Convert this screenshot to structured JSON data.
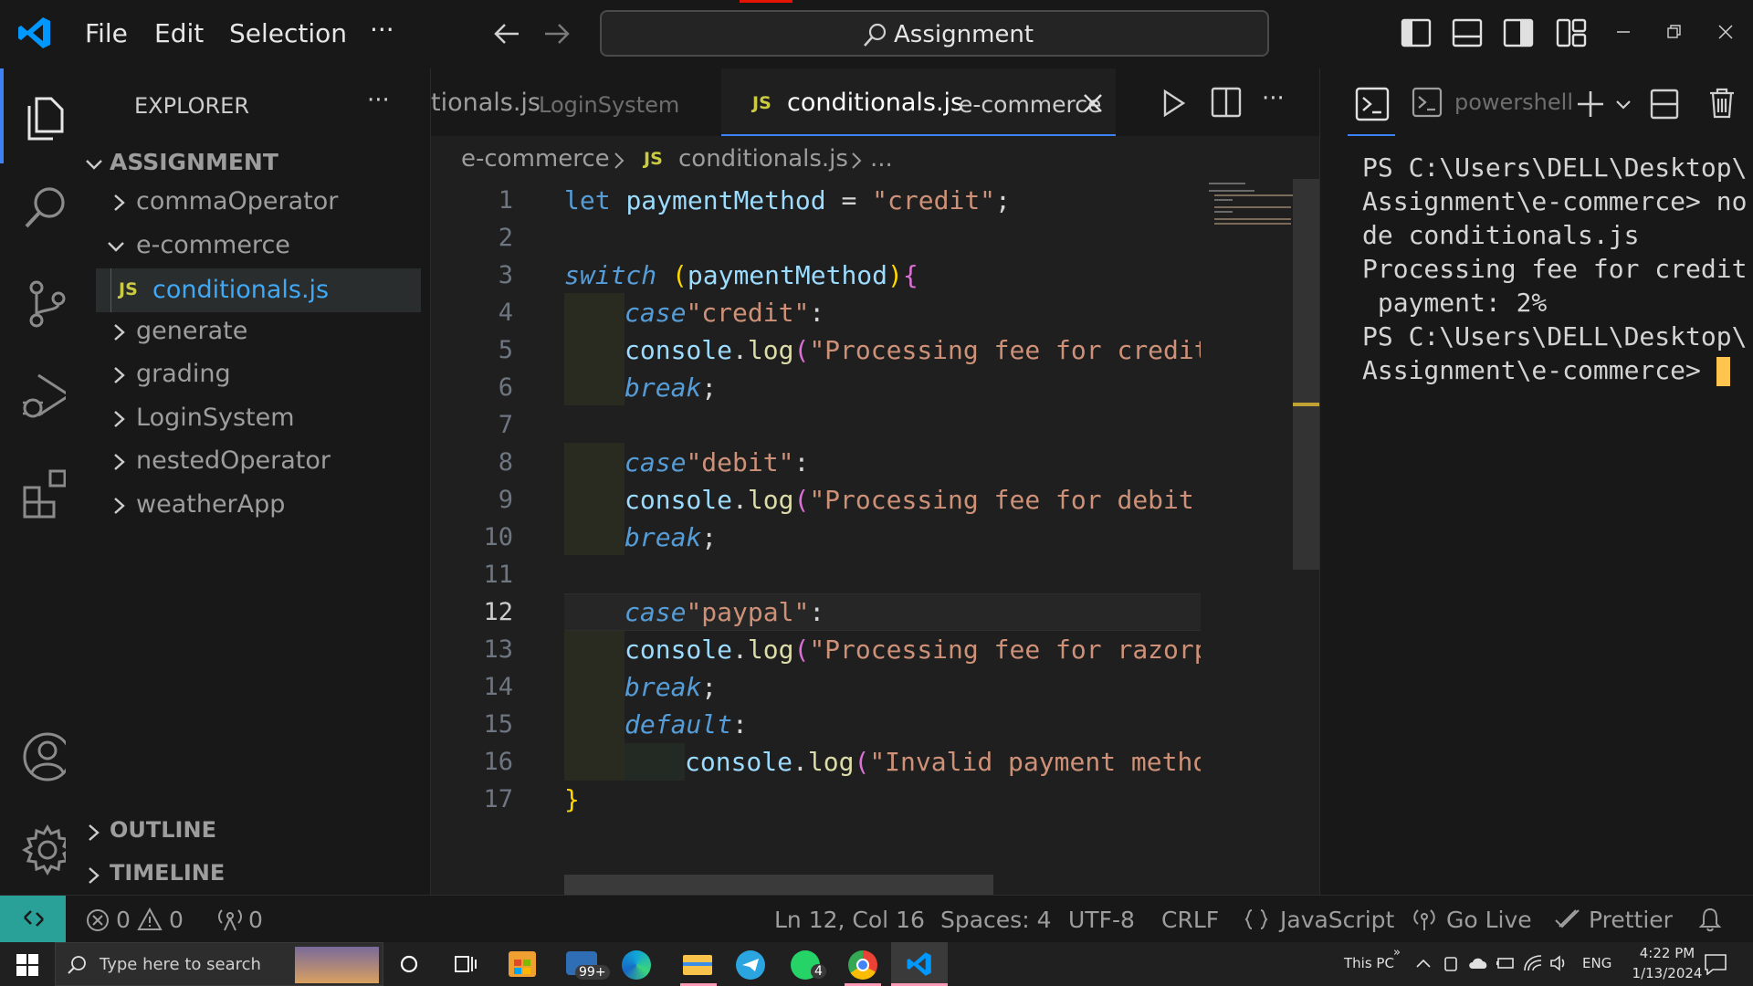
{
  "titlebar": {
    "menu": [
      "File",
      "Edit",
      "Selection",
      "···"
    ],
    "search_label": "Assignment"
  },
  "sidebar": {
    "title": "EXPLORER",
    "more": "···",
    "root": "ASSIGNMENT",
    "items": [
      {
        "label": "commaOperator",
        "expanded": false
      },
      {
        "label": "e-commerce",
        "expanded": true
      },
      {
        "label": "conditionals.js",
        "file": true,
        "badge": "JS"
      },
      {
        "label": "generate",
        "expanded": false
      },
      {
        "label": "grading",
        "expanded": false
      },
      {
        "label": "LoginSystem",
        "expanded": false
      },
      {
        "label": "nestedOperator",
        "expanded": false
      },
      {
        "label": "weatherApp",
        "expanded": false
      }
    ],
    "outline": "OUTLINE",
    "timeline": "TIMELINE"
  },
  "tabs": [
    {
      "name": "tionals.js",
      "folder": "LoginSystem",
      "active": false
    },
    {
      "badge": "JS",
      "name": "conditionals.js",
      "folder": "e-commerce",
      "active": true
    }
  ],
  "breadcrumb": {
    "folder": "e-commerce",
    "badge": "JS",
    "file": "conditionals.js",
    "more": "..."
  },
  "code": {
    "line_numbers": [
      "1",
      "2",
      "3",
      "4",
      "5",
      "6",
      "7",
      "8",
      "9",
      "10",
      "11",
      "12",
      "13",
      "14",
      "15",
      "16",
      "17"
    ],
    "current_line": "12"
  },
  "terminal": {
    "shell": "powershell",
    "lines": [
      "PS C:\\Users\\DELL\\Desktop\\",
      "Assignment\\e-commerce> no",
      "de conditionals.js",
      "Processing fee for credit",
      " payment: 2%",
      "PS C:\\Users\\DELL\\Desktop\\",
      "Assignment\\e-commerce> "
    ]
  },
  "statusbar": {
    "errors": "0",
    "warnings": "0",
    "ports": "0",
    "position": "Ln 12, Col 16",
    "spaces": "Spaces: 4",
    "encoding": "UTF-8",
    "eol": "CRLF",
    "language": "JavaScript",
    "golive": "Go Live",
    "prettier": "Prettier"
  },
  "taskbar": {
    "search_placeholder": "Type here to search",
    "mail_badge": "99+",
    "whatsapp_badge": "4",
    "this_pc": "This PC",
    "lang": "ENG",
    "time": "4:22 PM",
    "date": "1/13/2024"
  },
  "colors": {
    "accent": "#3b82f6",
    "js_badge": "#cbcb41",
    "vscode_blue": "#0098ff"
  }
}
